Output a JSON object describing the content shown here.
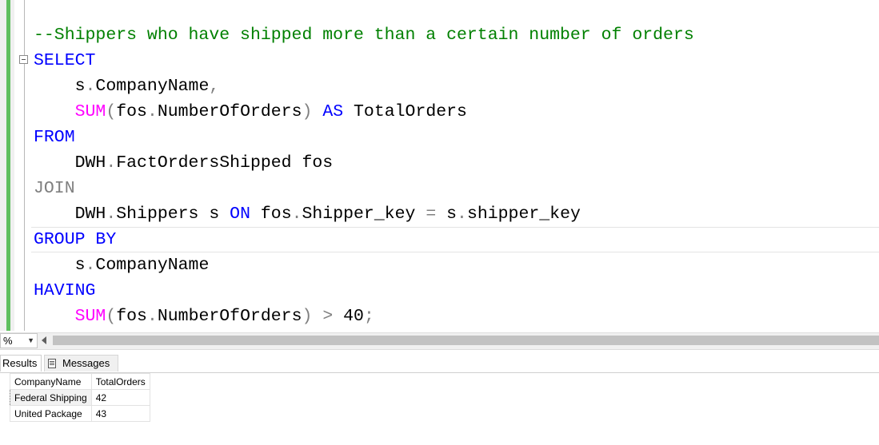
{
  "editor": {
    "lines": [
      [
        {
          "t": "--Shippers who have shipped more than a certain number of orders",
          "c": "cm"
        }
      ],
      [
        {
          "t": "SELECT",
          "c": "kw"
        }
      ],
      [
        {
          "t": "    s",
          "c": "tx"
        },
        {
          "t": ".",
          "c": "gr"
        },
        {
          "t": "CompanyName",
          "c": "tx"
        },
        {
          "t": ",",
          "c": "gr"
        }
      ],
      [
        {
          "t": "    ",
          "c": "tx"
        },
        {
          "t": "SUM",
          "c": "fn"
        },
        {
          "t": "(",
          "c": "gr"
        },
        {
          "t": "fos",
          "c": "tx"
        },
        {
          "t": ".",
          "c": "gr"
        },
        {
          "t": "NumberOfOrders",
          "c": "tx"
        },
        {
          "t": ")",
          "c": "gr"
        },
        {
          "t": " ",
          "c": "tx"
        },
        {
          "t": "AS",
          "c": "kw"
        },
        {
          "t": " TotalOrders",
          "c": "tx"
        }
      ],
      [
        {
          "t": "FROM",
          "c": "kw"
        }
      ],
      [
        {
          "t": "    DWH",
          "c": "tx"
        },
        {
          "t": ".",
          "c": "gr"
        },
        {
          "t": "FactOrdersShipped fos",
          "c": "tx"
        }
      ],
      [
        {
          "t": "JOIN",
          "c": "gr"
        }
      ],
      [
        {
          "t": "    DWH",
          "c": "tx"
        },
        {
          "t": ".",
          "c": "gr"
        },
        {
          "t": "Shippers s ",
          "c": "tx"
        },
        {
          "t": "ON",
          "c": "kw"
        },
        {
          "t": " fos",
          "c": "tx"
        },
        {
          "t": ".",
          "c": "gr"
        },
        {
          "t": "Shipper_key ",
          "c": "tx"
        },
        {
          "t": "=",
          "c": "gr"
        },
        {
          "t": " s",
          "c": "tx"
        },
        {
          "t": ".",
          "c": "gr"
        },
        {
          "t": "shipper_key",
          "c": "tx"
        }
      ],
      [
        {
          "t": "GROUP BY",
          "c": "kw"
        }
      ],
      [
        {
          "t": "    s",
          "c": "tx"
        },
        {
          "t": ".",
          "c": "gr"
        },
        {
          "t": "CompanyName",
          "c": "tx"
        }
      ],
      [
        {
          "t": "HAVING",
          "c": "kw"
        }
      ],
      [
        {
          "t": "    ",
          "c": "tx"
        },
        {
          "t": "SUM",
          "c": "fn"
        },
        {
          "t": "(",
          "c": "gr"
        },
        {
          "t": "fos",
          "c": "tx"
        },
        {
          "t": ".",
          "c": "gr"
        },
        {
          "t": "NumberOfOrders",
          "c": "tx"
        },
        {
          "t": ")",
          "c": "gr"
        },
        {
          "t": " ",
          "c": "tx"
        },
        {
          "t": ">",
          "c": "gr"
        },
        {
          "t": " 40",
          "c": "tx"
        },
        {
          "t": ";",
          "c": "gr"
        }
      ]
    ],
    "current_line": 8
  },
  "statusbar": {
    "zoom_value": "%",
    "zoom_arrow": "▼"
  },
  "tabs": {
    "results_label": "Results",
    "messages_label": "Messages"
  },
  "results": {
    "columns": [
      "CompanyName",
      "TotalOrders"
    ],
    "rows": [
      [
        "Federal Shipping",
        "42"
      ],
      [
        "United Package",
        "43"
      ]
    ]
  },
  "colors": {
    "comment": "#008000",
    "keyword": "#0000ff",
    "function": "#ff00ff",
    "operator": "#808080",
    "gutter_change": "#5fbf5f"
  }
}
